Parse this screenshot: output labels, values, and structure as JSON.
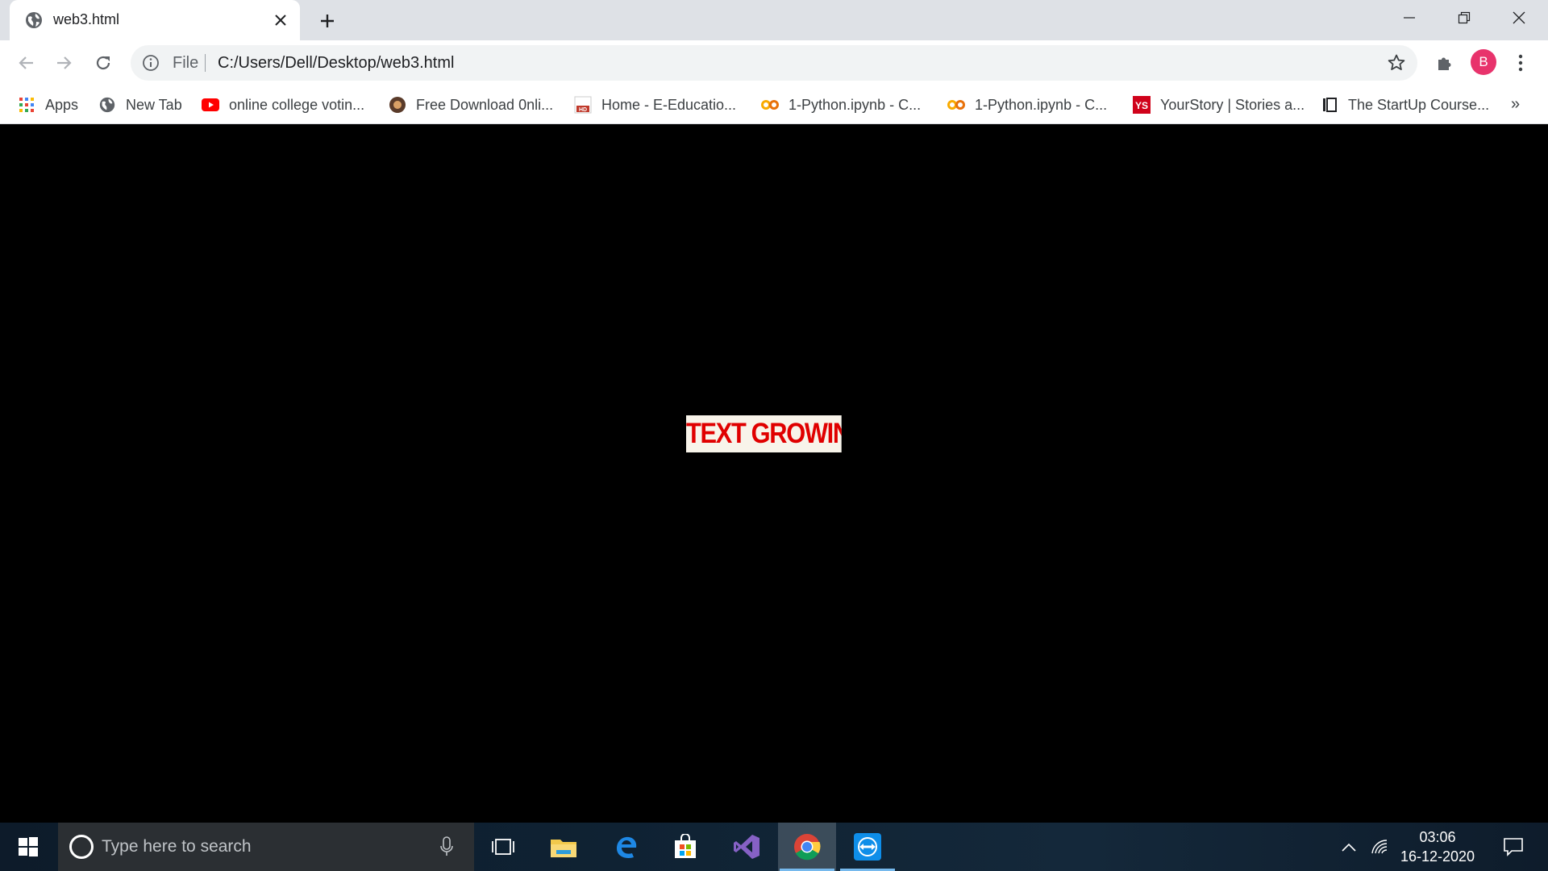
{
  "browser": {
    "tab": {
      "title": "web3.html",
      "favicon": "globe-icon"
    },
    "window_controls": [
      "minimize-icon",
      "restore-icon",
      "close-icon"
    ],
    "address": {
      "scheme_label": "File",
      "url": "C:/Users/Dell/Desktop/web3.html"
    },
    "profile_initial": "B"
  },
  "bookmarks": [
    {
      "label": "Apps",
      "icon": "apps-grid-icon"
    },
    {
      "label": "New Tab",
      "icon": "globe-icon"
    },
    {
      "label": "online college votin...",
      "icon": "youtube-icon"
    },
    {
      "label": "Free Download 0nli...",
      "icon": "site-icon"
    },
    {
      "label": "Home - E-Educatio...",
      "icon": "hd-site-icon"
    },
    {
      "label": "1-Python.ipynb - C...",
      "icon": "colab-icon"
    },
    {
      "label": "1-Python.ipynb - C...",
      "icon": "colab-icon"
    },
    {
      "label": "YourStory | Stories a...",
      "icon": "yourstory-icon"
    },
    {
      "label": "The StartUp Course...",
      "icon": "startup-course-icon"
    }
  ],
  "bookmarks_overflow": "»",
  "page": {
    "text": "TEXT GROWING",
    "text_color": "#e00000",
    "text_background": "#f8f4ea",
    "page_background": "#000000"
  },
  "taskbar": {
    "search_placeholder": "Type here to search",
    "apps": [
      "task-view-icon",
      "file-explorer-icon",
      "edge-icon",
      "store-icon",
      "visual-studio-icon",
      "chrome-icon",
      "teamviewer-icon"
    ],
    "active_app": "chrome-icon",
    "time": "03:06",
    "date": "16-12-2020"
  }
}
